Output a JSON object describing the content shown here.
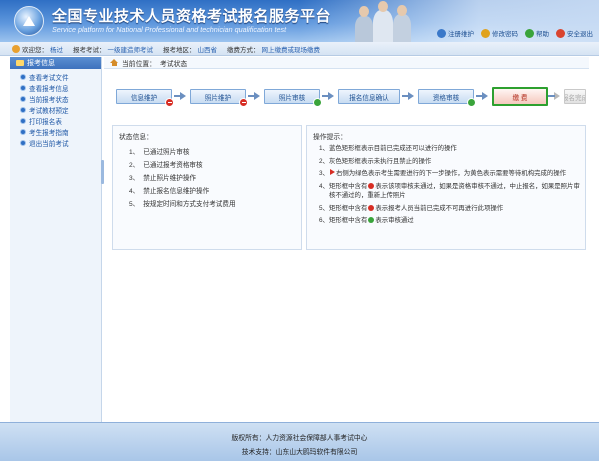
{
  "header": {
    "title": "全国专业技术人员资格考试报名服务平台",
    "subtitle": "Service platform for National Professional and technician qualification test",
    "links": [
      {
        "label": "注册维护",
        "icon": "person-icon",
        "color": "#3a78c9"
      },
      {
        "label": "修改密码",
        "icon": "key-icon",
        "color": "#e0a21d"
      },
      {
        "label": "帮助",
        "icon": "help-icon",
        "color": "#3aa43b"
      },
      {
        "label": "安全退出",
        "icon": "exit-icon",
        "color": "#d9442f"
      }
    ]
  },
  "infobar": {
    "welcome_label": "欢迎您：",
    "welcome_user": "杨过",
    "exam_label": "报考考试：",
    "exam_value": "一级建造师考试",
    "region_label": "报考地区：",
    "region_value": "山西省",
    "payment_label": "缴费方式：",
    "payment_value": "网上缴费或现场缴费"
  },
  "sidebar": {
    "heading": "报考信息",
    "items": [
      {
        "label": "查看考试文件"
      },
      {
        "label": "查看报考信息"
      },
      {
        "label": "当前报考状态"
      },
      {
        "label": "考试教材预定"
      },
      {
        "label": "打印报名表"
      },
      {
        "label": "考生报考指南"
      },
      {
        "label": "退出当前考试"
      }
    ]
  },
  "breadcrumb": {
    "label": "当前位置：",
    "current": "考试状态"
  },
  "progress": {
    "steps": [
      {
        "label": "信息维护",
        "status": "red"
      },
      {
        "label": "照片维护",
        "status": "red"
      },
      {
        "label": "照片审核",
        "status": "green"
      },
      {
        "label": "报名信息确认",
        "status": "none"
      },
      {
        "label": "资格审核",
        "status": "green"
      },
      {
        "label": "缴 费",
        "status": "current"
      },
      {
        "label": "报名完成",
        "status": "disabled"
      }
    ]
  },
  "status_panel": {
    "title": "状态信息：",
    "items": [
      {
        "num": "1、",
        "text": "已通过照片审核"
      },
      {
        "num": "2、",
        "text": "已通过报考资格审核"
      },
      {
        "num": "3、",
        "text": "禁止照片维护操作"
      },
      {
        "num": "4、",
        "text": "禁止报名信息维护操作"
      },
      {
        "num": "5、",
        "text": "按规定时间和方式支付考试费用"
      }
    ]
  },
  "tips_panel": {
    "title": "操作提示：",
    "items": [
      {
        "num": "1、",
        "text": "蓝色矩形框表示目前已完成还可以进行的操作"
      },
      {
        "num": "2、",
        "text": "灰色矩形框表示未执行且禁止的操作"
      },
      {
        "num": "3、",
        "pre": "",
        "post": "右侧为绿色表示考生需要进行的下一步操作，为黄色表示需要等待机构完成的操作"
      },
      {
        "num": "4、",
        "pre": "矩形框中含有",
        "post": "表示该项审核未通过，如果是资格审核不通过，中止报名，如果是照片审核不通过的，重新上传照片"
      },
      {
        "num": "5、",
        "pre": "矩形框中含有",
        "post": "表示报考人员当前已完成不可再进行此项操作"
      },
      {
        "num": "6、",
        "pre": "矩形框中含有",
        "post": "表示审核通过"
      }
    ]
  },
  "footer": {
    "copyright": "版权所有：人力资源社会保障部人事考试中心",
    "tech_support": "技术支持：山东山大鸥玛软件有限公司"
  },
  "colors": {
    "brand": "#2f6fc4",
    "error": "#d72d24",
    "success": "#3aa43b",
    "current_step_border": "#2da02f"
  }
}
